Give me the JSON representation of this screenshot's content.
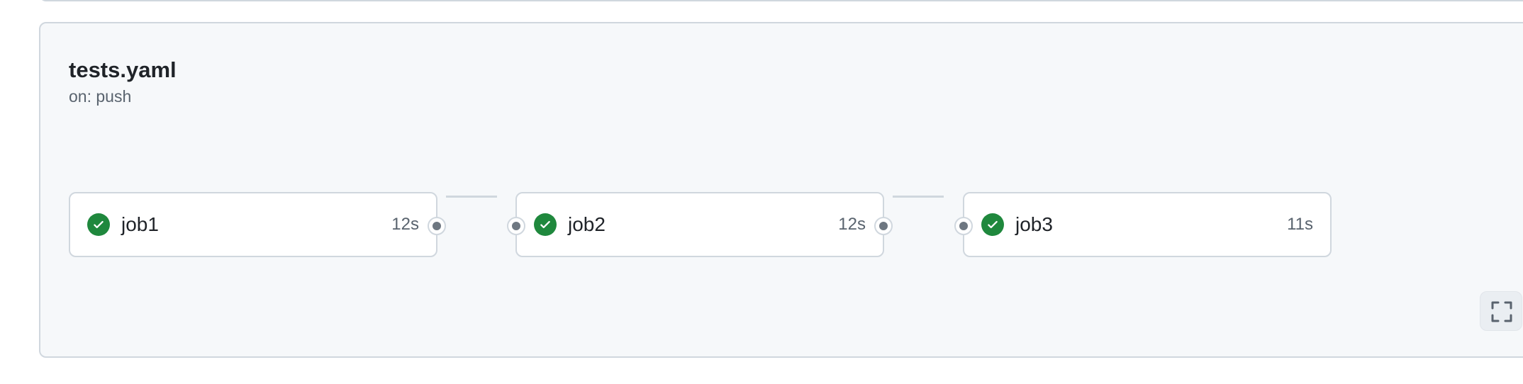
{
  "workflow": {
    "title": "tests.yaml",
    "trigger": "on: push"
  },
  "jobs": [
    {
      "name": "job1",
      "duration": "12s",
      "status": "success",
      "status_icon": "check-circle-icon"
    },
    {
      "name": "job2",
      "duration": "12s",
      "status": "success",
      "status_icon": "check-circle-icon"
    },
    {
      "name": "job3",
      "duration": "11s",
      "status": "success",
      "status_icon": "check-circle-icon"
    }
  ],
  "controls": {
    "fullscreen_icon": "fullscreen-icon"
  },
  "colors": {
    "success": "#1f883d",
    "panel_background": "#f6f8fa",
    "border": "#d0d7de",
    "port": "#6e7781",
    "muted_text": "#59636e"
  }
}
